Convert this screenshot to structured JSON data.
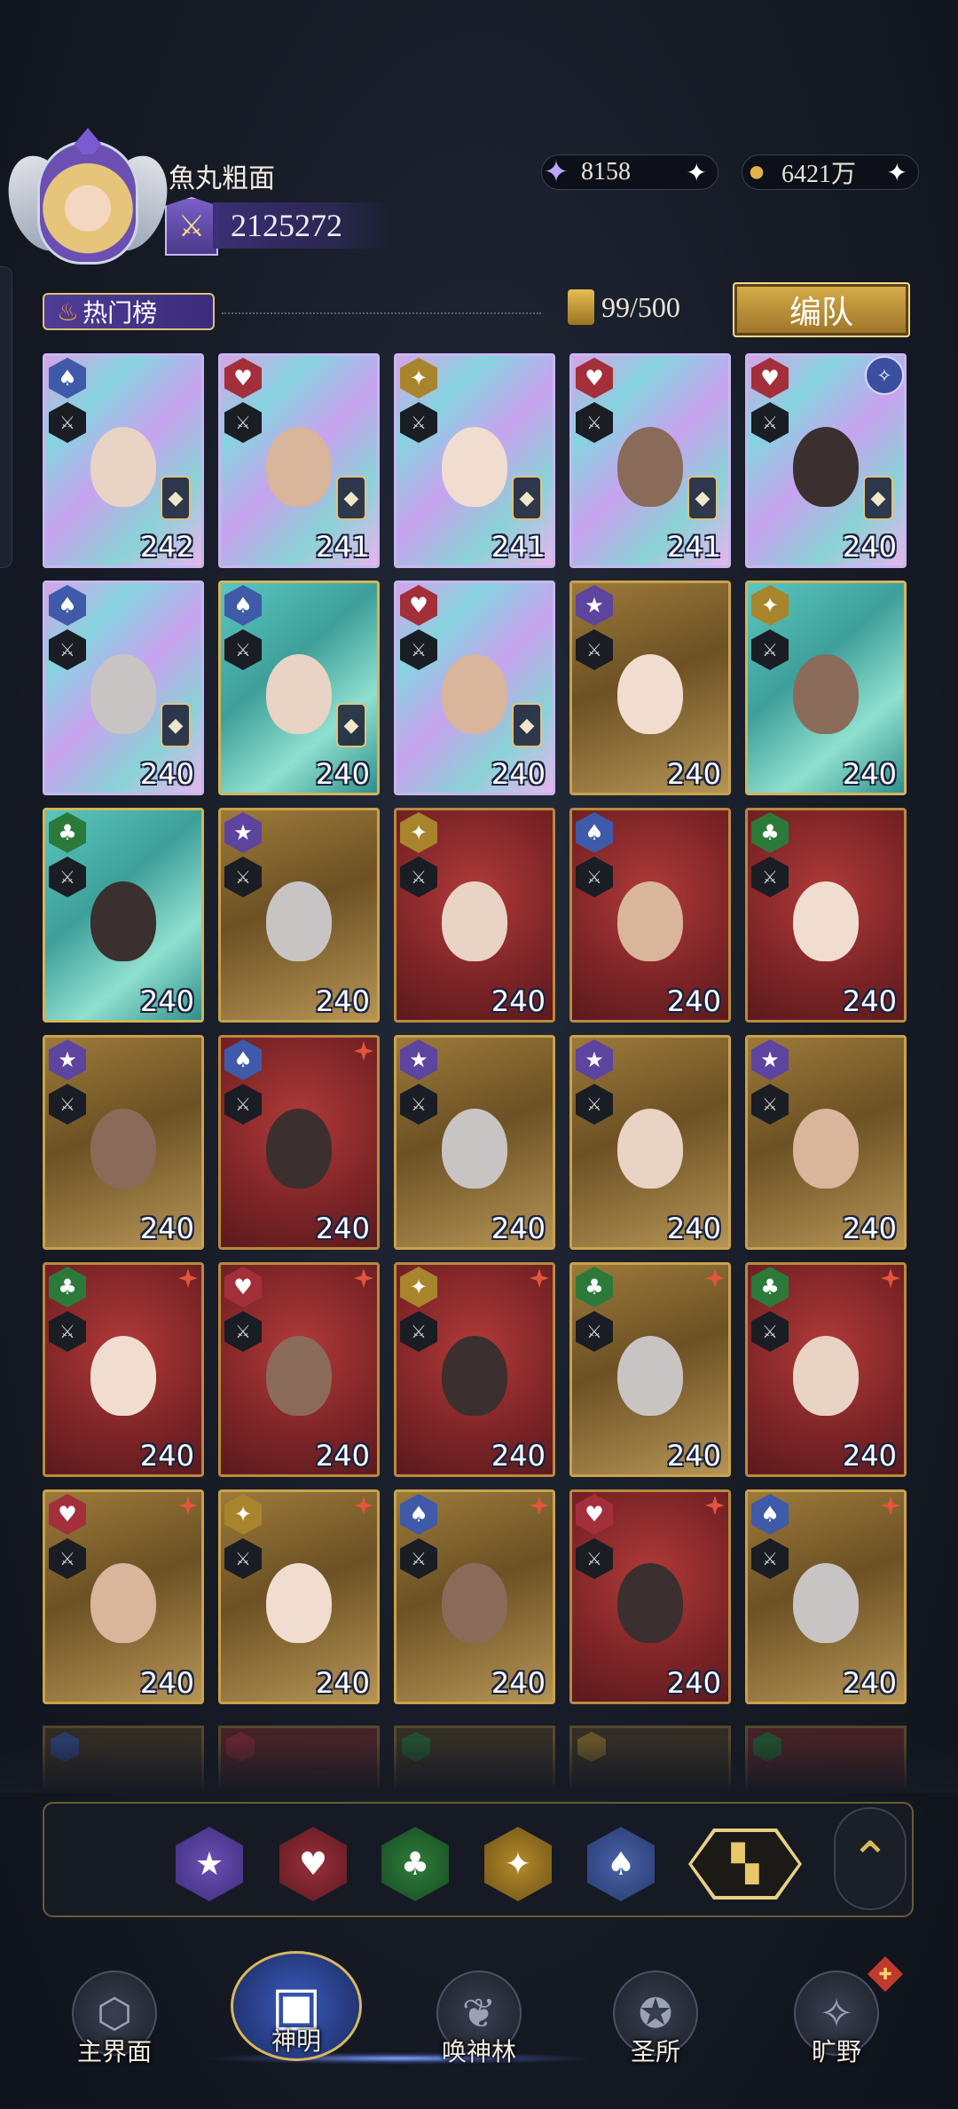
{
  "player": {
    "name": "魚丸粗面",
    "power": "2125272"
  },
  "currencies": {
    "gems": "8158",
    "gold": "6421万",
    "plus": "✦"
  },
  "toolbar": {
    "hot_list": "热门榜",
    "card_count": "99/500",
    "team_button": "编队"
  },
  "cards": [
    {
      "suit": "spade",
      "rarity": "holo",
      "level": "242",
      "rank": true
    },
    {
      "suit": "heart",
      "rarity": "holo",
      "level": "241",
      "rank": true
    },
    {
      "suit": "diamond",
      "rarity": "holo",
      "level": "241",
      "rank": true
    },
    {
      "suit": "heart",
      "rarity": "holo",
      "level": "241",
      "rank": true
    },
    {
      "suit": "heart",
      "rarity": "holo",
      "level": "240",
      "rank": true,
      "sigil": true
    },
    {
      "suit": "spade",
      "rarity": "holo",
      "level": "240",
      "rank": true
    },
    {
      "suit": "spade",
      "rarity": "teal",
      "level": "240",
      "rank": true
    },
    {
      "suit": "heart",
      "rarity": "holo",
      "level": "240",
      "rank": true
    },
    {
      "suit": "star",
      "rarity": "gold",
      "level": "240"
    },
    {
      "suit": "diamond",
      "rarity": "teal",
      "level": "240"
    },
    {
      "suit": "club",
      "rarity": "teal",
      "level": "240"
    },
    {
      "suit": "star",
      "rarity": "gold",
      "level": "240"
    },
    {
      "suit": "diamond",
      "rarity": "red",
      "level": "240"
    },
    {
      "suit": "spade",
      "rarity": "red",
      "level": "240"
    },
    {
      "suit": "club",
      "rarity": "red",
      "level": "240"
    },
    {
      "suit": "star",
      "rarity": "gold",
      "level": "240"
    },
    {
      "suit": "spade",
      "rarity": "red",
      "level": "240",
      "star": true
    },
    {
      "suit": "star",
      "rarity": "gold",
      "level": "240"
    },
    {
      "suit": "star",
      "rarity": "gold",
      "level": "240"
    },
    {
      "suit": "star",
      "rarity": "gold",
      "level": "240"
    },
    {
      "suit": "club",
      "rarity": "red",
      "level": "240",
      "star": true
    },
    {
      "suit": "heart",
      "rarity": "red",
      "level": "240",
      "star": true
    },
    {
      "suit": "diamond",
      "rarity": "red",
      "level": "240",
      "star": true
    },
    {
      "suit": "club",
      "rarity": "gold",
      "level": "240",
      "star": true
    },
    {
      "suit": "club",
      "rarity": "red",
      "level": "240",
      "star": true
    },
    {
      "suit": "heart",
      "rarity": "gold",
      "level": "240",
      "star": true
    },
    {
      "suit": "diamond",
      "rarity": "gold",
      "level": "240",
      "star": true
    },
    {
      "suit": "spade",
      "rarity": "gold",
      "level": "240",
      "star": true
    },
    {
      "suit": "heart",
      "rarity": "red",
      "level": "240",
      "star": true
    },
    {
      "suit": "spade",
      "rarity": "gold",
      "level": "240",
      "star": true
    }
  ],
  "partial_row": [
    "spade",
    "heart",
    "club",
    "diamond",
    "club"
  ],
  "suit_colors": {
    "spade": "#3e5aa8",
    "heart": "#a32f3b",
    "diamond": "#a8842c",
    "club": "#2c7a3a",
    "star": "#5d449f"
  },
  "suit_glyphs": {
    "spade": "♠",
    "heart": "♥",
    "diamond": "✦",
    "club": "♣",
    "star": "★"
  },
  "filters": {
    "star": "★",
    "heart": "♥",
    "club": "♣",
    "diamond": "✦",
    "spade": "♠",
    "all": "▚",
    "collapse": "⌃"
  },
  "nav": {
    "main": "主界面",
    "god": "神明",
    "forest": "唤神林",
    "sanctuary": "圣所",
    "wild": "旷野"
  }
}
